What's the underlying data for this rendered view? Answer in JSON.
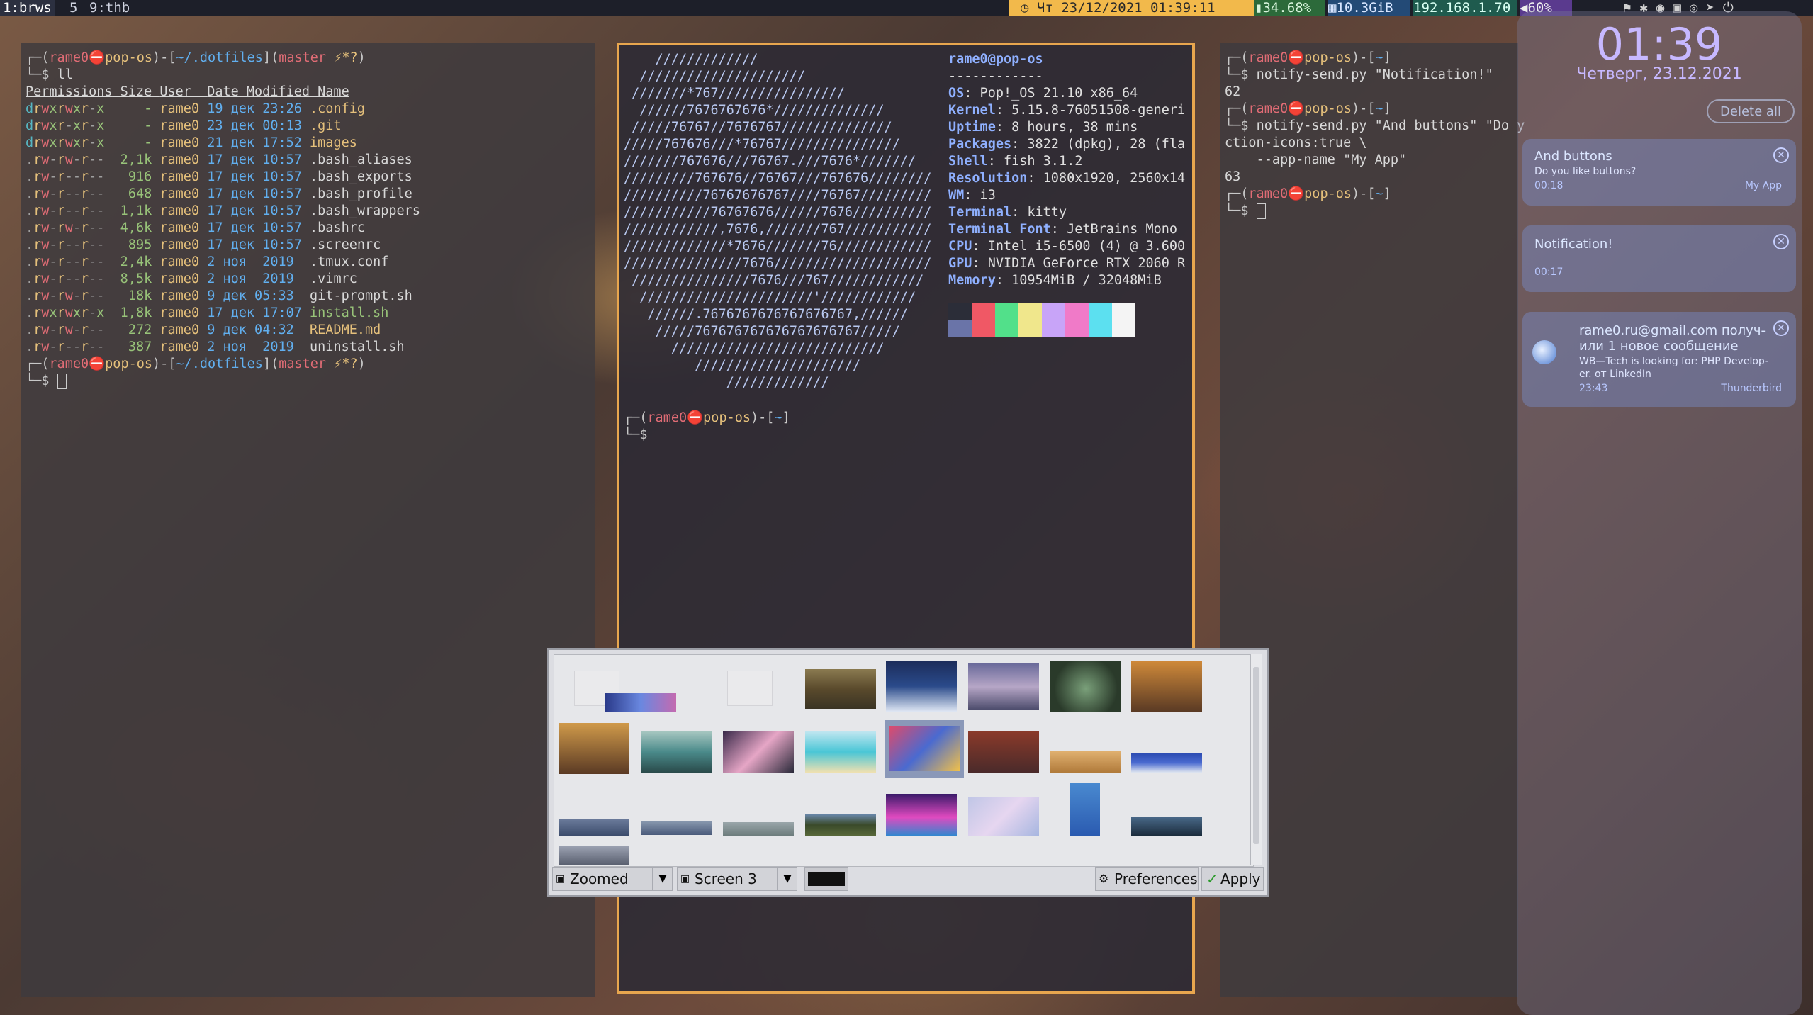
{
  "topbar": {
    "workspaces": [
      "1:brws",
      "5",
      "9:thb"
    ],
    "clock_text": "Чт 23/12/2021 01:39:11",
    "battery": "34.68%",
    "memory": "10.3GiB",
    "ip": "192.168.1.70",
    "volume": "60%"
  },
  "left_terminal": {
    "prompt_user": "rame0",
    "prompt_host": "pop-os",
    "prompt_dir": "~/.dotfiles",
    "prompt_branch": "master",
    "prompt_flags": "⚡*?",
    "command": "ll",
    "headers": [
      "Permissions",
      "Size",
      "User",
      "Date Modified",
      "Name"
    ],
    "rows": [
      {
        "perm": "drwxrwxr-x",
        "size": "-",
        "user": "rame0",
        "date": "19 дек 23:26",
        "name": ".config"
      },
      {
        "perm": "drwxr-xr-x",
        "size": "-",
        "user": "rame0",
        "date": "23 дек 00:13",
        "name": ".git"
      },
      {
        "perm": "drwxrwxr-x",
        "size": "-",
        "user": "rame0",
        "date": "21 дек 17:52",
        "name": "images"
      },
      {
        "perm": ".rw-rw-r--",
        "size": "2,1k",
        "user": "rame0",
        "date": "17 дек 10:57",
        "name": ".bash_aliases"
      },
      {
        "perm": ".rw-r--r--",
        "size": "916",
        "user": "rame0",
        "date": "17 дек 10:57",
        "name": ".bash_exports"
      },
      {
        "perm": ".rw-r--r--",
        "size": "648",
        "user": "rame0",
        "date": "17 дек 10:57",
        "name": ".bash_profile"
      },
      {
        "perm": ".rw-r--r--",
        "size": "1,1k",
        "user": "rame0",
        "date": "17 дек 10:57",
        "name": ".bash_wrappers"
      },
      {
        "perm": ".rw-rw-r--",
        "size": "4,6k",
        "user": "rame0",
        "date": "17 дек 10:57",
        "name": ".bashrc"
      },
      {
        "perm": ".rw-r--r--",
        "size": "895",
        "user": "rame0",
        "date": "17 дек 10:57",
        "name": ".screenrc"
      },
      {
        "perm": ".rw-r--r--",
        "size": "2,4k",
        "user": "rame0",
        "date": "2 ноя  2019",
        "name": ".tmux.conf"
      },
      {
        "perm": ".rw-r--r--",
        "size": "8,5k",
        "user": "rame0",
        "date": "2 ноя  2019",
        "name": ".vimrc"
      },
      {
        "perm": ".rw-rw-r--",
        "size": "18k",
        "user": "rame0",
        "date": "9 дек 05:33",
        "name": "git-prompt.sh"
      },
      {
        "perm": ".rwxrwxr-x",
        "size": "1,8k",
        "user": "rame0",
        "date": "17 дек 17:07",
        "name": "install.sh"
      },
      {
        "perm": ".rw-rw-r--",
        "size": "272",
        "user": "rame0",
        "date": "9 дек 04:32",
        "name": "README.md"
      },
      {
        "perm": ".rw-r--r--",
        "size": "387",
        "user": "rame0",
        "date": "2 ноя  2019",
        "name": "uninstall.sh"
      }
    ],
    "cursor_line": "└─$ "
  },
  "center_terminal": {
    "logo_lines": [
      "    /////////////",
      "  /////////////////////",
      " ///////*767////////////////",
      "  //////7676767676*//////////////",
      " /////76767//7676767//////////////",
      "/////767676///*76767///////////////",
      "///////767676///76767.///7676*///////",
      "/////////767676//76767///767676////////",
      "//////////76767676767////76767/////////",
      "///////////76767676//////7676//////////",
      "////////////,7676,///////767///////////",
      "/////////////*7676///////76////////////",
      "///////////////7676////////////////////",
      " ///////////////7676///767////////////",
      "  //////////////////////'////////////",
      "   //////.7676767676767676767,//////",
      "    /////767676767676767676767/////",
      "      ///////////////////////////",
      "         /////////////////////",
      "             /////////////"
    ],
    "header": "rame0@pop-os",
    "divider": "------------",
    "info": [
      {
        "k": "OS",
        "v": "Pop!_OS 21.10 x86_64"
      },
      {
        "k": "Kernel",
        "v": "5.15.8-76051508-generi"
      },
      {
        "k": "Uptime",
        "v": "8 hours, 38 mins"
      },
      {
        "k": "Packages",
        "v": "3822 (dpkg), 28 (fla"
      },
      {
        "k": "Shell",
        "v": "fish 3.1.2"
      },
      {
        "k": "Resolution",
        "v": "1080x1920, 2560x14"
      },
      {
        "k": "WM",
        "v": "i3"
      },
      {
        "k": "Terminal",
        "v": "kitty"
      },
      {
        "k": "Terminal Font",
        "v": "JetBrains Mono"
      },
      {
        "k": "CPU",
        "v": "Intel i5-6500 (4) @ 3.600"
      },
      {
        "k": "GPU",
        "v": "NVIDIA GeForce RTX 2060 R"
      },
      {
        "k": "Memory",
        "v": "10954MiB / 32048MiB"
      }
    ],
    "palette_top": [
      "#2b2d38",
      "#f05865",
      "#52e08a",
      "#f0e78c",
      "#c8a4f8",
      "#f07ac8",
      "#5ce0f0",
      "#f4f4f4"
    ],
    "palette_bottom": [
      "#6a74a8",
      "#f05865",
      "#52e08a",
      "#f0e78c",
      "#c8a4f8",
      "#f07ac8",
      "#5ce0f0",
      "#f4f4f4"
    ],
    "prompt_dir": "~"
  },
  "right_terminal": {
    "prompt_dir": "~",
    "cmd1": "notify-send.py \"Notification!\"",
    "out1": "62",
    "cmd2": "notify-send.py \"And buttons\" \"Do y",
    "cmd2_cont1": "ction-icons:true \\",
    "cmd2_cont2": "    --app-name \"My App\"",
    "out2": "63"
  },
  "picker": {
    "mode": "Zoomed",
    "screen": "Screen 3",
    "preferences_label": "Preferences",
    "apply_label": "Apply"
  },
  "notifications": {
    "time": "01:39",
    "date": "Четверг, 23.12.2021",
    "delete_all": "Delete all",
    "items": [
      {
        "title": "And buttons",
        "body": "Do you like buttons?",
        "time": "00:18",
        "app": "My App"
      },
      {
        "title": "Notification!",
        "body": "",
        "time": "00:17",
        "app": ""
      },
      {
        "title": "rame0.ru@gmail.com получ-",
        "title2": "или 1 новое сообщение",
        "body": "WB—Tech is looking for: PHP Develop-",
        "body2": "er. от LinkedIn",
        "time": "23:43",
        "app": "Thunderbird"
      }
    ]
  }
}
